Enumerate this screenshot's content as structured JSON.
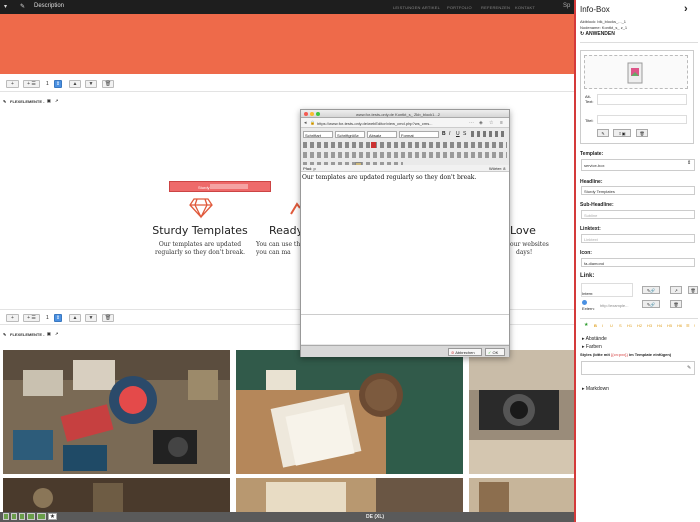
{
  "topbar": {
    "description": "Description",
    "menu": [
      "LEISTUNGEN",
      "ARTIKEL",
      "PORTFOLIO",
      "REFERENZEN",
      "KONTAKT"
    ],
    "sp": "Sp"
  },
  "toolbar1": {
    "add": "+",
    "addlist": "+ ☰",
    "count": "1",
    "up": "▲",
    "down": "▼",
    "trash": "🗑"
  },
  "fl1": "FLEXELEMENTE - ",
  "fl2": "FLEXELEMENTE - ",
  "edit_tag": "Sturdy",
  "features": [
    {
      "heading": "Sturdy Templates",
      "text": [
        "Our templates are updated",
        "regularly so they don't break."
      ]
    },
    {
      "heading": "Ready",
      "text": [
        "You can use thi",
        "you can ma"
      ]
    },
    {
      "heading": "Love",
      "text": [
        "our websites",
        "days!"
      ]
    }
  ],
  "status": {
    "label": "DE (XL)"
  },
  "popup": {
    "titlebar": "www.for-tests-only.de Kontkt_s_ Zkb_block1...2",
    "url": "https://www.for-tests-only.de/webEditor/view_cmd.php?ws_cms...",
    "selects": [
      "Schriftart",
      "Schriftgröße",
      "Absatz",
      "Format"
    ],
    "path": "Pfad: p",
    "wordcount": "Wörter: 8",
    "body": "Our templates are updated regularly so they don't break.",
    "cancel": "Abbrechen",
    "ok": "OK"
  },
  "sidebar": {
    "title": "Info-Box",
    "meta1": "Aktblock: blk_blocks_..._1",
    "meta2": "Nodename: Kontkt_s_ z_1",
    "apply": "ANWENDEN",
    "alt_label": "Alt-Text:",
    "title_label": "Titel:",
    "template_label": "Template:",
    "template_value": "service-box",
    "headline_label": "Headline:",
    "headline_value": "Sturdy Templates",
    "subheadline_label": "Sub-Headline:",
    "subheadline_placeholder": "Subline",
    "linktext_label": "Linktext:",
    "linktext_placeholder": "Linktext",
    "icon_label": "Icon:",
    "icon_value": "fa-diamond",
    "link_label": "Link:",
    "intern_label": "Intern:",
    "extern_label": "Extern:",
    "extern_placeholder": "http://example...",
    "abstaende": "Abstände",
    "farben": "Farben",
    "styles_label": "Styles (bitte mit",
    "styles_code": "{{cn:pxx}}",
    "styles_suffix": "im Template einfügen)",
    "markdown": "Markdown",
    "format_icons": [
      "★",
      "B",
      "I",
      "U",
      "S",
      "H1",
      "H2",
      "H3",
      "H4",
      "H5",
      "H6",
      "☰",
      "!"
    ]
  },
  "colors": {
    "hero": "#ee6a4a",
    "accent": "#d43a3a",
    "diamond": "#e05a3c"
  }
}
